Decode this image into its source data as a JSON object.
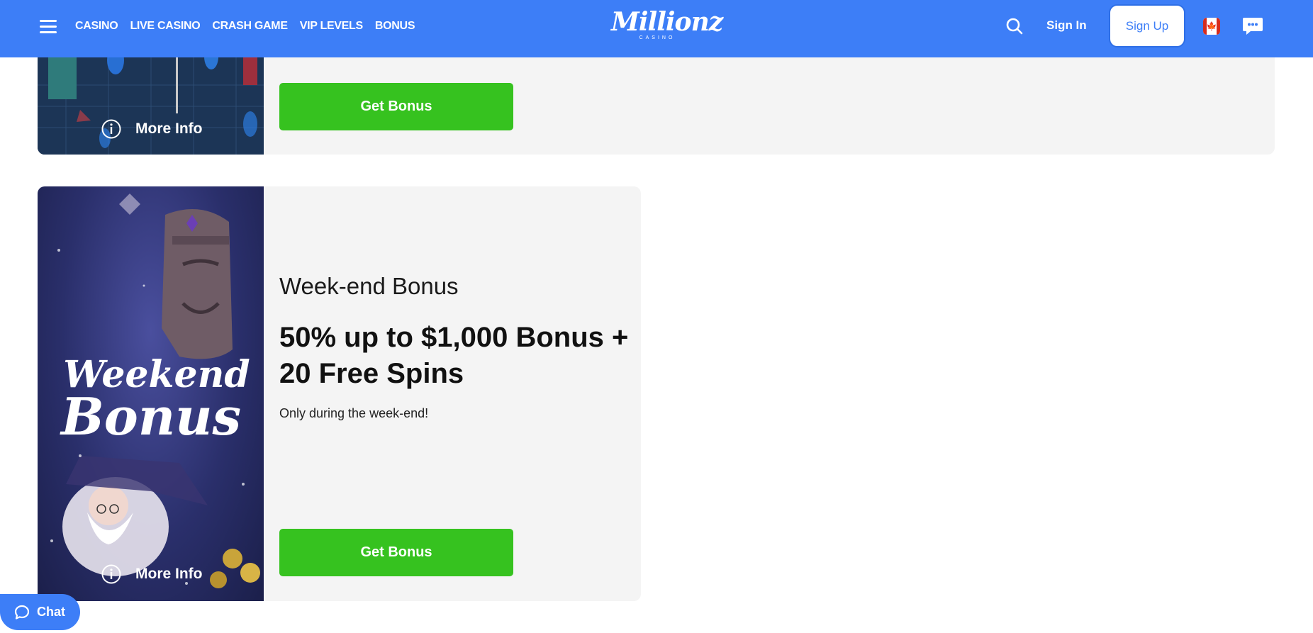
{
  "nav": {
    "items": [
      "CASINO",
      "LIVE CASINO",
      "CRASH GAME",
      "VIP LEVELS",
      "BONUS"
    ]
  },
  "brand": {
    "logo": "Millionz",
    "logo_sub": "CASINO"
  },
  "header": {
    "signin_label": "Sign In",
    "signup_label": "Sign Up"
  },
  "cards": [
    {
      "more_info_label": "More Info",
      "button_label": "Get Bonus"
    },
    {
      "title": "Week-end Bonus",
      "headline": "50% up to $1,000 Bonus + 20 Free Spins",
      "description": "Only during the week-end!",
      "more_info_label": "More Info",
      "button_label": "Get Bonus",
      "image_text_1": "Weekend",
      "image_text_2": "Bonus"
    }
  ],
  "chat": {
    "label": "Chat"
  },
  "colors": {
    "header": "#3d7ef7",
    "button": "#36c21f",
    "card": "#f4f4f4"
  }
}
